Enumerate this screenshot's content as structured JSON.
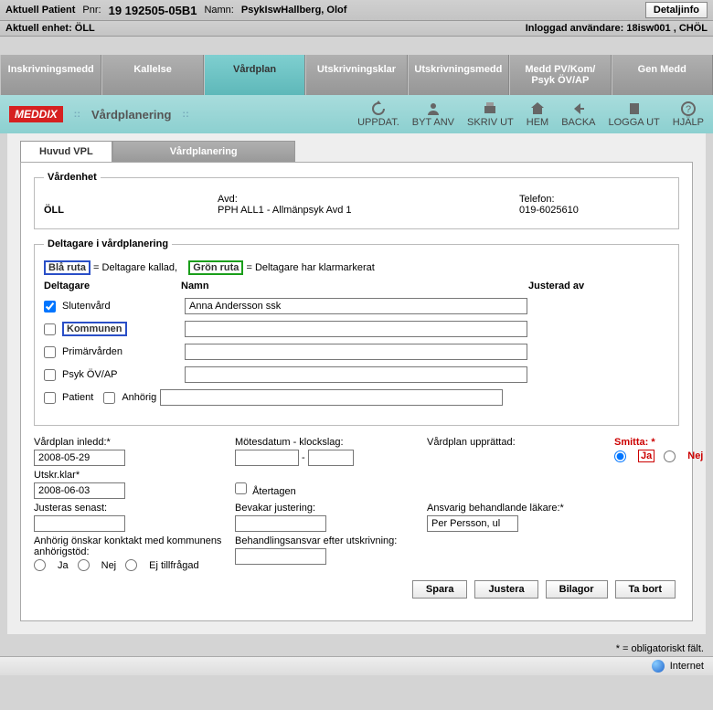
{
  "header": {
    "patient_label": "Aktuell Patient",
    "pnr_label": "Pnr:",
    "pnr": "19 192505-05B1",
    "name_label": "Namn:",
    "name": "PsykIswHallberg, Olof",
    "detail_btn": "Detaljinfo",
    "unit_label": "Aktuell enhet: ÖLL",
    "user_label": "Inloggad användare: 18isw001 , CHÖL"
  },
  "tabs": [
    "Inskrivningsmedd",
    "Kallelse",
    "Vårdplan",
    "Utskrivningsklar",
    "Utskrivningsmedd",
    "Medd PV/Kom/ Psyk ÖV/AP",
    "Gen Medd"
  ],
  "active_tab": 2,
  "logo": "MEDDIX",
  "toolbar_title": "Vårdplanering",
  "toolbar_icons": [
    "UPPDAT.",
    "BYT ANV",
    "SKRIV UT",
    "HEM",
    "BACKA",
    "LOGGA UT",
    "HJÄLP"
  ],
  "inner_tabs": [
    "Huvud VPL",
    "Vårdplanering"
  ],
  "vard": {
    "legend": "Vårdenhet",
    "unit": "ÖLL",
    "avd_label": "Avd:",
    "avd": "PPH ALL1 - Allmänpsyk Avd 1",
    "tel_label": "Telefon:",
    "tel": "019-6025610"
  },
  "delt": {
    "legend": "Deltagare i vårdplanering",
    "blue": "Blå ruta",
    "blue_txt": " = Deltagare kallad,",
    "green": "Grön ruta",
    "green_txt": " = Deltagare har klarmarkerat",
    "h1": "Deltagare",
    "h2": "Namn",
    "h3": "Justerad av",
    "rows": [
      {
        "label": "Slutenvård",
        "checked": true,
        "value": "Anna Andersson ssk",
        "box": ""
      },
      {
        "label": "Kommunen",
        "checked": false,
        "value": "",
        "box": "blue"
      },
      {
        "label": "Primärvården",
        "checked": false,
        "value": "",
        "box": ""
      },
      {
        "label": "Psyk ÖV/AP",
        "checked": false,
        "value": "",
        "box": ""
      }
    ],
    "patient": "Patient",
    "anhorig": "Anhörig"
  },
  "fields": {
    "inledd_l": "Vårdplan inledd:*",
    "inledd": "2008-05-29",
    "motes_l": "Mötesdatum - klockslag:",
    "motes_d": "",
    "motes_t": "",
    "uppr_l": "Vårdplan upprättad:",
    "smitta_l": "Smitta: *",
    "ja": "Ja",
    "nej": "Nej",
    "utskr_l": "Utskr.klar*",
    "utskr": "2008-06-03",
    "ater": "Återtagen",
    "just_l": "Justeras senast:",
    "just": "",
    "bevak_l": "Bevakar justering:",
    "bevak": "",
    "ansv_l": "Ansvarig behandlande läkare:*",
    "ansv": "Per Persson, ul",
    "anh_l": "Anhörig önskar konktakt med kommunens anhörigstöd:",
    "beh_l": "Behandlingsansvar efter utskrivning:",
    "beh": "",
    "ej": "Ej tillfrågad"
  },
  "footer": [
    "Spara",
    "Justera",
    "Bilagor",
    "Ta bort"
  ],
  "note": "* = obligatoriskt fält.",
  "status": "Internet"
}
